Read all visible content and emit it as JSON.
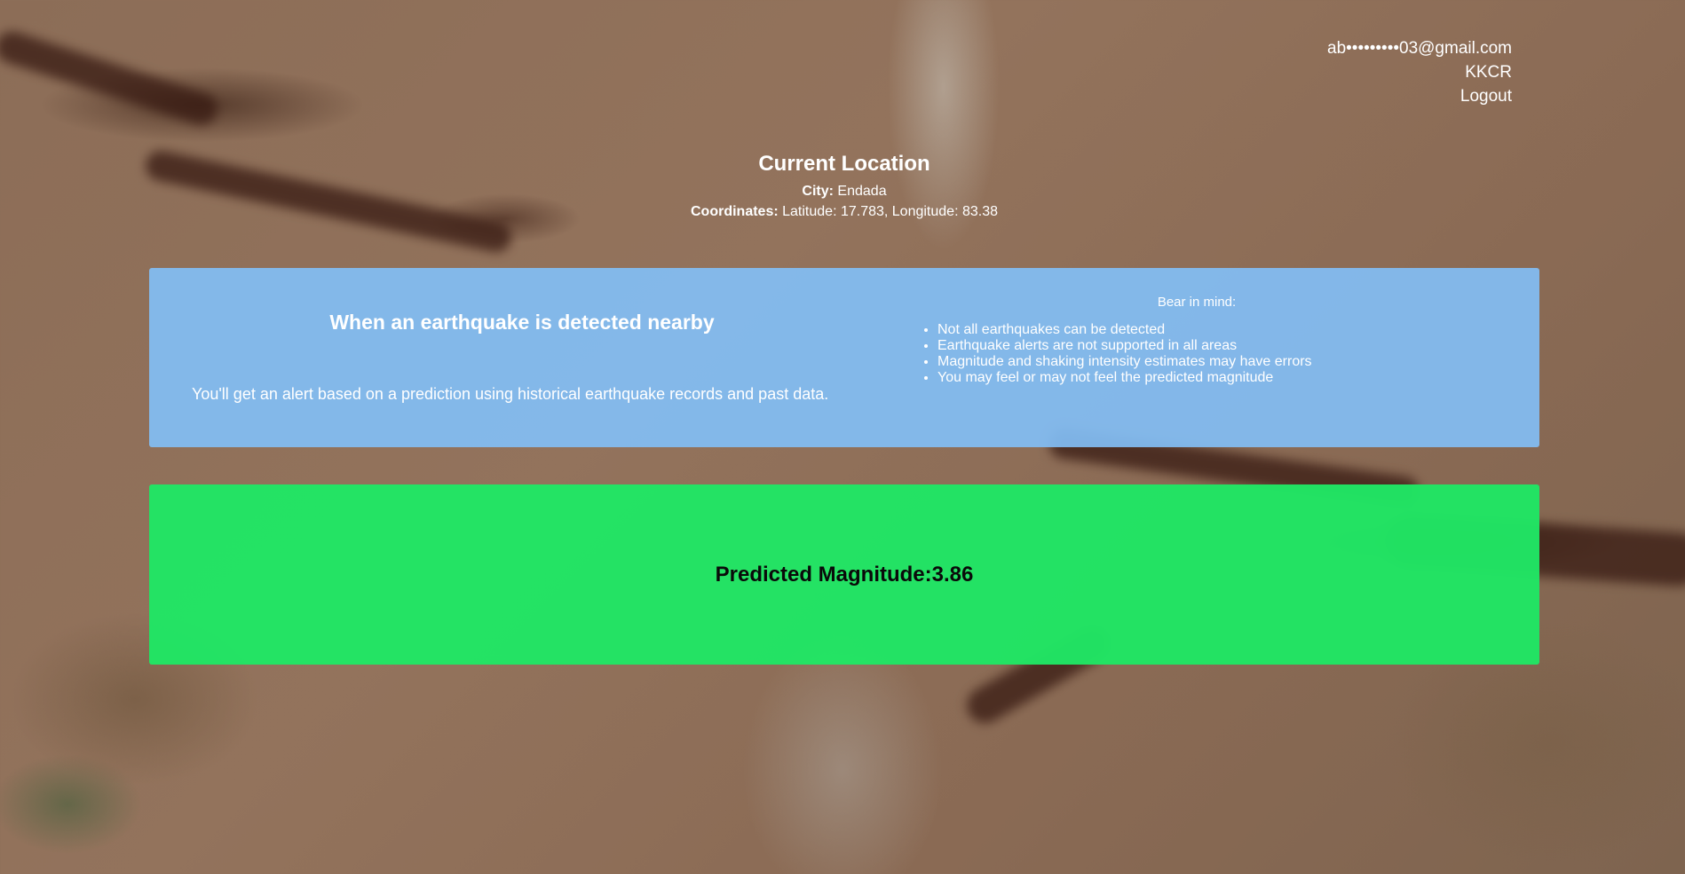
{
  "header": {
    "email": "ab•••••••••03@gmail.com",
    "username": "KKCR",
    "logout_label": "Logout"
  },
  "location": {
    "title": "Current Location",
    "city_label": "City:",
    "city_value": "Endada",
    "coords_label": "Coordinates:",
    "coords_value": "Latitude: 17.783, Longitude: 83.38"
  },
  "info": {
    "heading": "When an earthquake is detected nearby",
    "description": "You'll get an alert based on a prediction using historical earthquake records and past data.",
    "bear_in_mind": "Bear in mind:",
    "points": [
      "Not all earthquakes can be detected",
      "Earthquake alerts are not supported in all areas",
      "Magnitude and shaking intensity estimates may have errors",
      "You may feel or may not feel the predicted magnitude"
    ]
  },
  "prediction": {
    "text": "Predicted Magnitude:3.86"
  },
  "colors": {
    "info_panel": "#82bef5",
    "prediction_panel": "#20e664"
  }
}
